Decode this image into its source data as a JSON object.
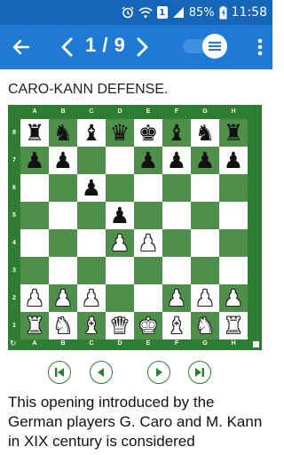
{
  "status_bar": {
    "battery": "85%",
    "sim": "1",
    "time": "11:58"
  },
  "app_bar": {
    "counter": "1 / 9",
    "toggle_on": true
  },
  "lesson": {
    "title": "CARO-KANN DEFENSE.",
    "description": "This opening introduced by the German players G. Caro and M. Kann in XIX century is considered"
  },
  "board": {
    "files": [
      "a",
      "b",
      "c",
      "d",
      "e",
      "f",
      "g",
      "h"
    ],
    "ranks": [
      "8",
      "7",
      "6",
      "5",
      "4",
      "3",
      "2",
      "1"
    ],
    "position": [
      [
        "br",
        "bn",
        "bb",
        "bq",
        "bk",
        "bb",
        "bn",
        "br"
      ],
      [
        "bp",
        "bp",
        "",
        "",
        "bp",
        "bp",
        "bp",
        "bp"
      ],
      [
        "",
        "",
        "bp",
        "",
        "",
        "",
        "",
        ""
      ],
      [
        "",
        "",
        "",
        "bp",
        "",
        "",
        "",
        ""
      ],
      [
        "",
        "",
        "",
        "wp",
        "wp",
        "",
        "",
        ""
      ],
      [
        "",
        "",
        "",
        "",
        "",
        "",
        "",
        ""
      ],
      [
        "wp",
        "wp",
        "wp",
        "",
        "",
        "wp",
        "wp",
        "wp"
      ],
      [
        "wr",
        "wn",
        "wb",
        "wq",
        "wk",
        "wb",
        "wn",
        "wr"
      ]
    ],
    "colors": {
      "light": "#ffffff",
      "dark": "#4f8f4a",
      "frame": "#2e7d32"
    }
  },
  "icons": {
    "back": "arrow-left-icon",
    "prev": "chevron-left-icon",
    "next": "chevron-right-icon",
    "menu": "menu-icon",
    "first": "skip-first-icon",
    "step_back": "step-back-icon",
    "step_forward": "step-forward-icon",
    "last": "skip-last-icon"
  },
  "theme": {
    "status_bar": "#1565b8",
    "app_bar": "#1e7ad4",
    "accent": "#2e7d32"
  }
}
